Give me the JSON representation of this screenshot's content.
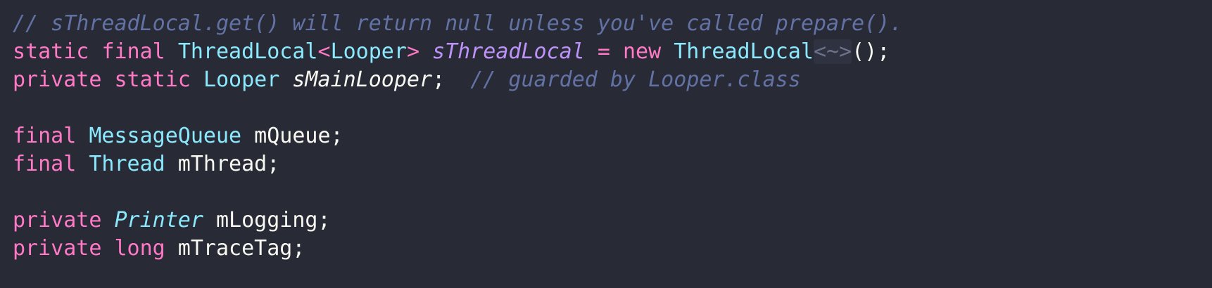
{
  "editor": {
    "lines": [
      {
        "tokens": [
          {
            "text": "// sThreadLocal.get() will return null unless you've called prepare().",
            "kind": "comment"
          }
        ]
      },
      {
        "tokens": [
          {
            "text": "static",
            "kind": "keyword"
          },
          {
            "text": " ",
            "kind": "plain"
          },
          {
            "text": "final",
            "kind": "keyword"
          },
          {
            "text": " ",
            "kind": "plain"
          },
          {
            "text": "ThreadLocal",
            "kind": "type"
          },
          {
            "text": "<",
            "kind": "keyword"
          },
          {
            "text": "Looper",
            "kind": "type"
          },
          {
            "text": ">",
            "kind": "keyword"
          },
          {
            "text": " ",
            "kind": "plain"
          },
          {
            "text": "sThreadLocal",
            "kind": "static-field"
          },
          {
            "text": " ",
            "kind": "plain"
          },
          {
            "text": "=",
            "kind": "keyword"
          },
          {
            "text": " ",
            "kind": "plain"
          },
          {
            "text": "new",
            "kind": "keyword"
          },
          {
            "text": " ",
            "kind": "plain"
          },
          {
            "text": "ThreadLocal",
            "kind": "type"
          },
          {
            "text": "<~>",
            "kind": "diamond"
          },
          {
            "text": "();",
            "kind": "plain"
          }
        ]
      },
      {
        "tokens": [
          {
            "text": "private",
            "kind": "keyword"
          },
          {
            "text": " ",
            "kind": "plain"
          },
          {
            "text": "static",
            "kind": "keyword"
          },
          {
            "text": " ",
            "kind": "plain"
          },
          {
            "text": "Looper",
            "kind": "type"
          },
          {
            "text": " ",
            "kind": "plain"
          },
          {
            "text": "sMainLooper",
            "kind": "italic-plain"
          },
          {
            "text": ";  ",
            "kind": "plain"
          },
          {
            "text": "// guarded by Looper.class",
            "kind": "comment"
          }
        ]
      },
      {
        "tokens": []
      },
      {
        "tokens": [
          {
            "text": "final",
            "kind": "keyword"
          },
          {
            "text": " ",
            "kind": "plain"
          },
          {
            "text": "MessageQueue",
            "kind": "type"
          },
          {
            "text": " mQueue;",
            "kind": "plain"
          }
        ]
      },
      {
        "tokens": [
          {
            "text": "final",
            "kind": "keyword"
          },
          {
            "text": " ",
            "kind": "plain"
          },
          {
            "text": "Thread",
            "kind": "type"
          },
          {
            "text": " mThread;",
            "kind": "plain"
          }
        ]
      },
      {
        "tokens": []
      },
      {
        "tokens": [
          {
            "text": "private",
            "kind": "keyword"
          },
          {
            "text": " ",
            "kind": "plain"
          },
          {
            "text": "Printer",
            "kind": "type-italic"
          },
          {
            "text": " mLogging;",
            "kind": "plain"
          }
        ]
      },
      {
        "tokens": [
          {
            "text": "private",
            "kind": "keyword"
          },
          {
            "text": " ",
            "kind": "plain"
          },
          {
            "text": "long",
            "kind": "keyword"
          },
          {
            "text": " mTraceTag;",
            "kind": "plain"
          }
        ]
      }
    ]
  },
  "theme": {
    "background": "#282a36",
    "comment": "#6272a4",
    "keyword": "#ff79c6",
    "type": "#8be9fd",
    "static_field": "#bd93f9",
    "plain": "#f8f8f2"
  }
}
